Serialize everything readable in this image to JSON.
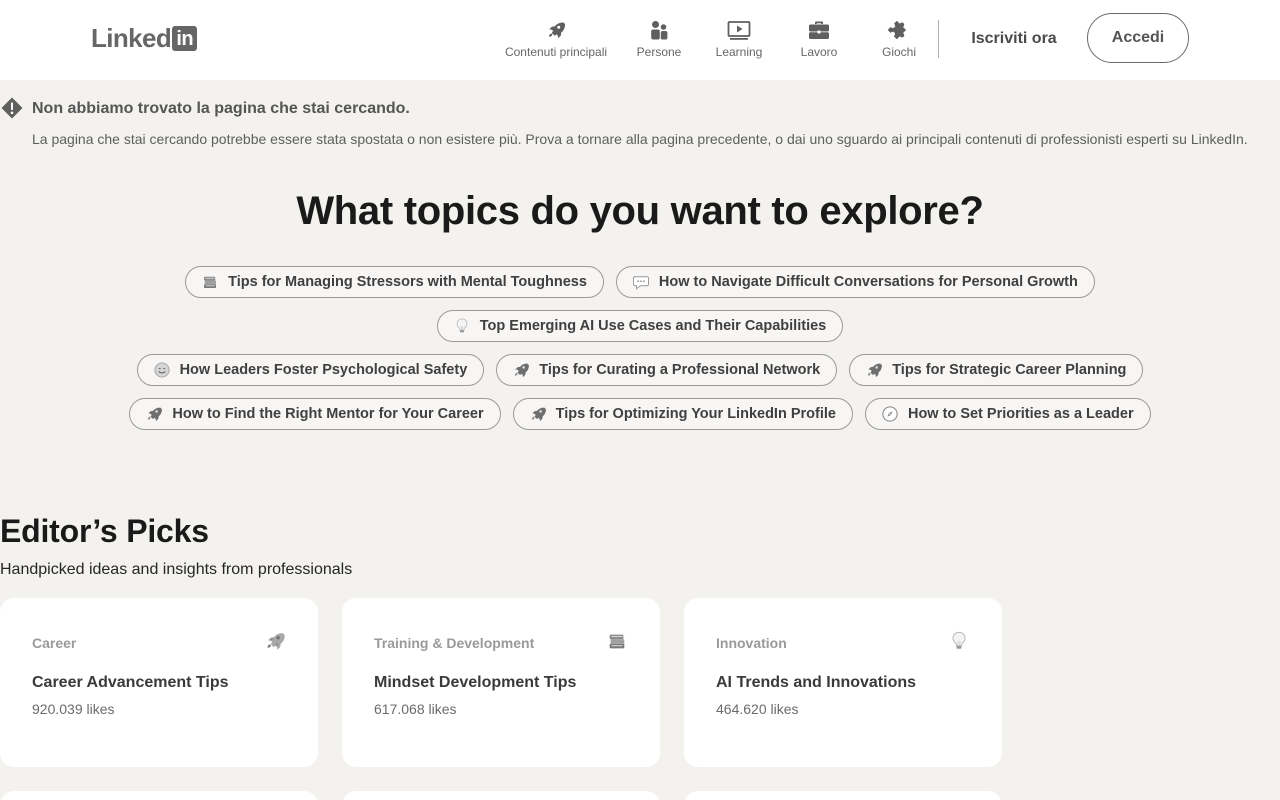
{
  "header": {
    "logo": {
      "text": "Linked",
      "box": "in"
    },
    "nav": [
      {
        "label": "Contenuti principali",
        "icon": "rocket-icon"
      },
      {
        "label": "Persone",
        "icon": "people-icon"
      },
      {
        "label": "Learning",
        "icon": "learning-icon"
      },
      {
        "label": "Lavoro",
        "icon": "briefcase-icon"
      },
      {
        "label": "Giochi",
        "icon": "puzzle-icon"
      }
    ],
    "join_label": "Iscriviti ora",
    "signin_label": "Accedi"
  },
  "error": {
    "title": "Non abbiamo trovato la pagina che stai cercando.",
    "description": "La pagina che stai cercando potrebbe essere stata spostata o non esistere più. Prova a tornare alla pagina precedente, o dai uno sguardo ai principali contenuti di professionisti esperti su LinkedIn."
  },
  "explore": {
    "title": "What topics do you want to explore?",
    "rows": [
      [
        {
          "label": "Tips for Managing Stressors with Mental Toughness",
          "emoji": "books"
        },
        {
          "label": "How to Navigate Difficult Conversations for Personal Growth",
          "emoji": "speech-bubble"
        }
      ],
      [
        {
          "label": "Top Emerging AI Use Cases and Their Capabilities",
          "emoji": "lightbulb"
        }
      ],
      [
        {
          "label": "How Leaders Foster Psychological Safety",
          "emoji": "smiley"
        },
        {
          "label": "Tips for Curating a Professional Network",
          "emoji": "rocket"
        },
        {
          "label": "Tips for Strategic Career Planning",
          "emoji": "rocket"
        }
      ],
      [
        {
          "label": "How to Find the Right Mentor for Your Career",
          "emoji": "rocket"
        },
        {
          "label": "Tips for Optimizing Your LinkedIn Profile",
          "emoji": "rocket"
        },
        {
          "label": "How to Set Priorities as a Leader",
          "emoji": "compass"
        }
      ]
    ]
  },
  "picks": {
    "title": "Editor’s Picks",
    "subtitle": "Handpicked ideas and insights from professionals",
    "cards": [
      {
        "category": "Career",
        "title": "Career Advancement Tips",
        "likes": "920.039 likes",
        "emoji": "rocket"
      },
      {
        "category": "Training & Development",
        "title": "Mindset Development Tips",
        "likes": "617.068 likes",
        "emoji": "books"
      },
      {
        "category": "Innovation",
        "title": "AI Trends and Innovations",
        "likes": "464.620 likes",
        "emoji": "lightbulb"
      }
    ]
  }
}
